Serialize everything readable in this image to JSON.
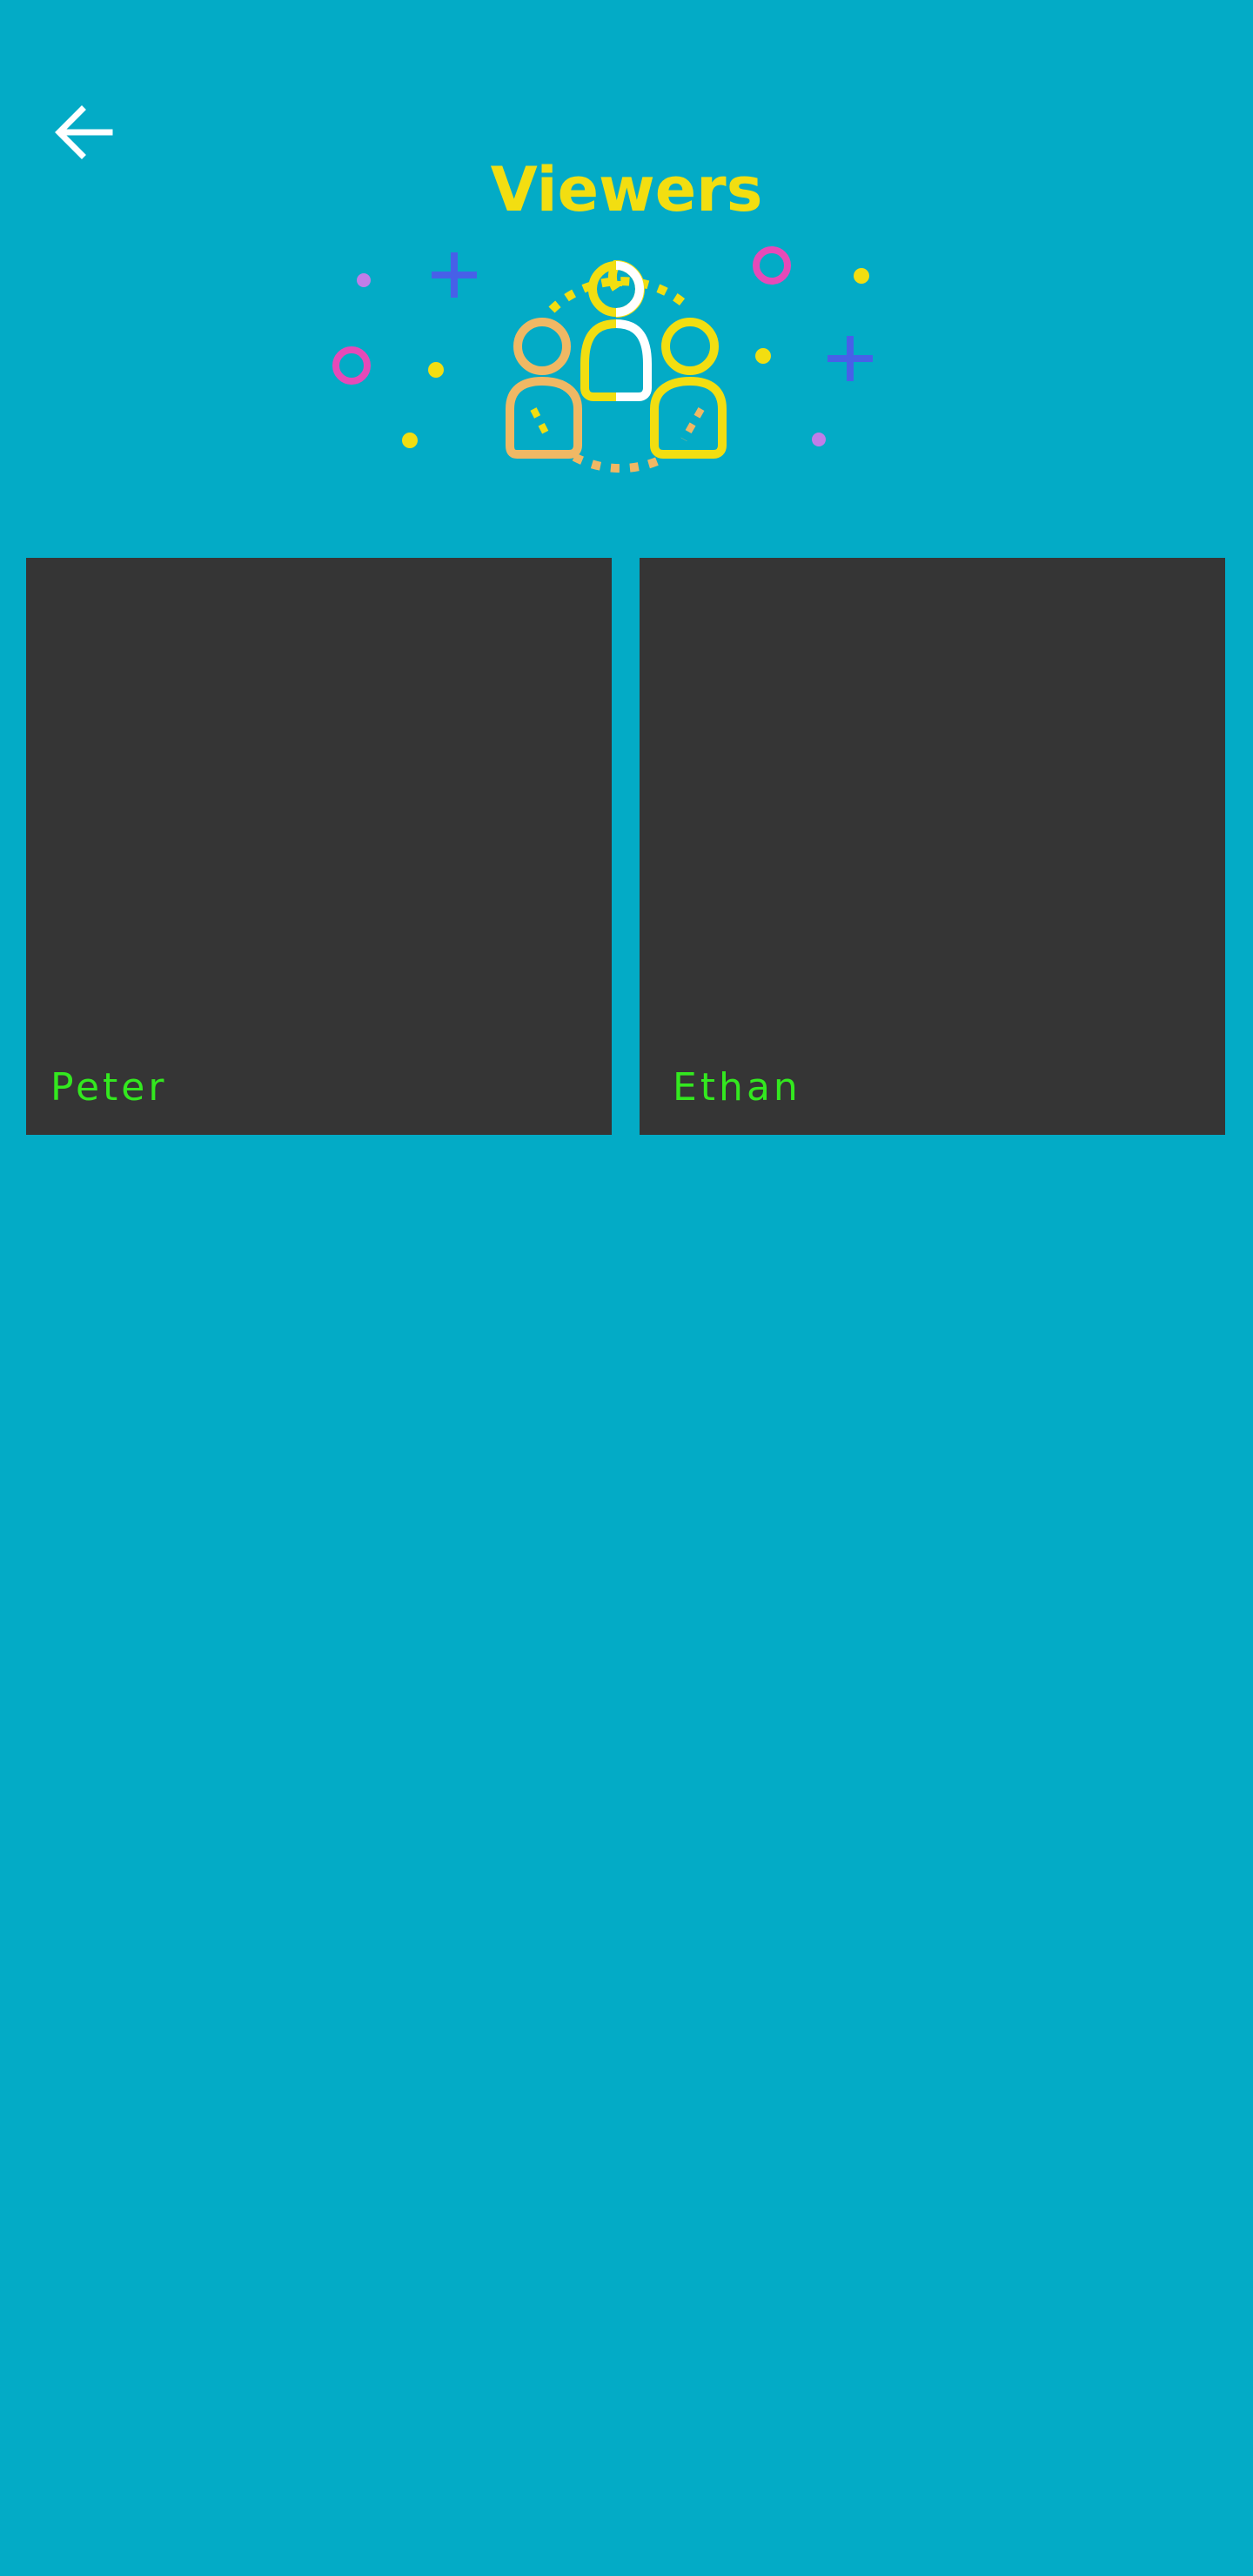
{
  "header": {
    "title": "Viewers",
    "back_icon": "arrow-left-icon",
    "back_icon_color": "#ffffff"
  },
  "illustration": {
    "icon": "viewers-group-icon",
    "decorations": [
      "plus-icon",
      "ring-icon",
      "dot-icon"
    ]
  },
  "viewers": [
    {
      "name": "Peter"
    },
    {
      "name": "Ethan"
    }
  ],
  "colors": {
    "background": "#03abc6",
    "title": "#f2de11",
    "card_background": "#353535",
    "viewer_name": "#33e81f",
    "accent_pink": "#e64ab8",
    "accent_blue": "#4760e8",
    "accent_purple": "#c07de8",
    "accent_orange": "#f0b864"
  }
}
